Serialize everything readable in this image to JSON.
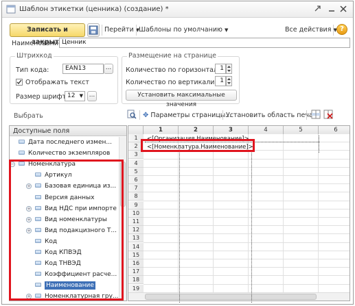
{
  "window": {
    "title": "Шаблон этикетки (ценника) (создание) *"
  },
  "toolbar": {
    "save_close": "Записать и закрыть",
    "goto": "Перейти",
    "templates": "Шаблоны по умолчанию",
    "all_actions": "Все действия",
    "help": "?"
  },
  "name_field": {
    "label": "Наименование:",
    "value": "Ценник"
  },
  "barcode": {
    "group_title": "Штрихкод",
    "type_label": "Тип кода:",
    "type_value": "EAN13",
    "show_text_label": "Отображать текст",
    "show_text_checked": true,
    "font_size_label": "Размер шрифта:",
    "font_size_value": "12"
  },
  "placement": {
    "group_title": "Размещение на странице",
    "horiz_label": "Количество по горизонтали:",
    "horiz_value": "1",
    "vert_label": "Количество по вертикали:",
    "vert_value": "1",
    "max_button": "Установить максимальные значения"
  },
  "select_link": "Выбрать",
  "fields_panel": {
    "header": "Доступные поля",
    "items": [
      {
        "label": "Дата последнего измен...",
        "level": 1,
        "expandable": false
      },
      {
        "label": "Количество экземпляров",
        "level": 1,
        "expandable": false
      },
      {
        "label": "Номенклатура",
        "level": 1,
        "expandable": true,
        "expanded": true
      },
      {
        "label": "Артикул",
        "level": 2,
        "expandable": false
      },
      {
        "label": "Базовая единица из...",
        "level": 2,
        "expandable": true
      },
      {
        "label": "Версия данных",
        "level": 2,
        "expandable": false
      },
      {
        "label": "Вид НДС при импорте",
        "level": 2,
        "expandable": true
      },
      {
        "label": "Вид номенклатуры",
        "level": 2,
        "expandable": true
      },
      {
        "label": "Вид подакцизного Т...",
        "level": 2,
        "expandable": true
      },
      {
        "label": "Код",
        "level": 2,
        "expandable": false
      },
      {
        "label": "Код КПВЭД",
        "level": 2,
        "expandable": false
      },
      {
        "label": "Код ТНВЭД",
        "level": 2,
        "expandable": false
      },
      {
        "label": "Коэффициент расче...",
        "level": 2,
        "expandable": false
      },
      {
        "label": "Наименование",
        "level": 2,
        "expandable": false,
        "selected": true
      },
      {
        "label": "Номенклатурная гру...",
        "level": 2,
        "expandable": true
      }
    ]
  },
  "sheet_toolbar": {
    "page_params": "Параметры страницы...",
    "set_print_area": "Установить область печати"
  },
  "sheet": {
    "columns": [
      "1",
      "2",
      "3",
      "4",
      "5",
      "6"
    ],
    "rows": [
      "1",
      "2",
      "3",
      "4",
      "5",
      "6",
      "7",
      "8",
      "9",
      "10",
      "11",
      "12",
      "13",
      "14",
      "15",
      "16",
      "17",
      "18",
      "19"
    ],
    "cell_r1": "<[Организация.Наименование]>",
    "cell_r2": "<[Номенклатура.Наименование]>"
  },
  "colors": {
    "accent_button": "#f6d86a",
    "selection": "#3d6fb6",
    "highlight_border": "#e0141e"
  }
}
